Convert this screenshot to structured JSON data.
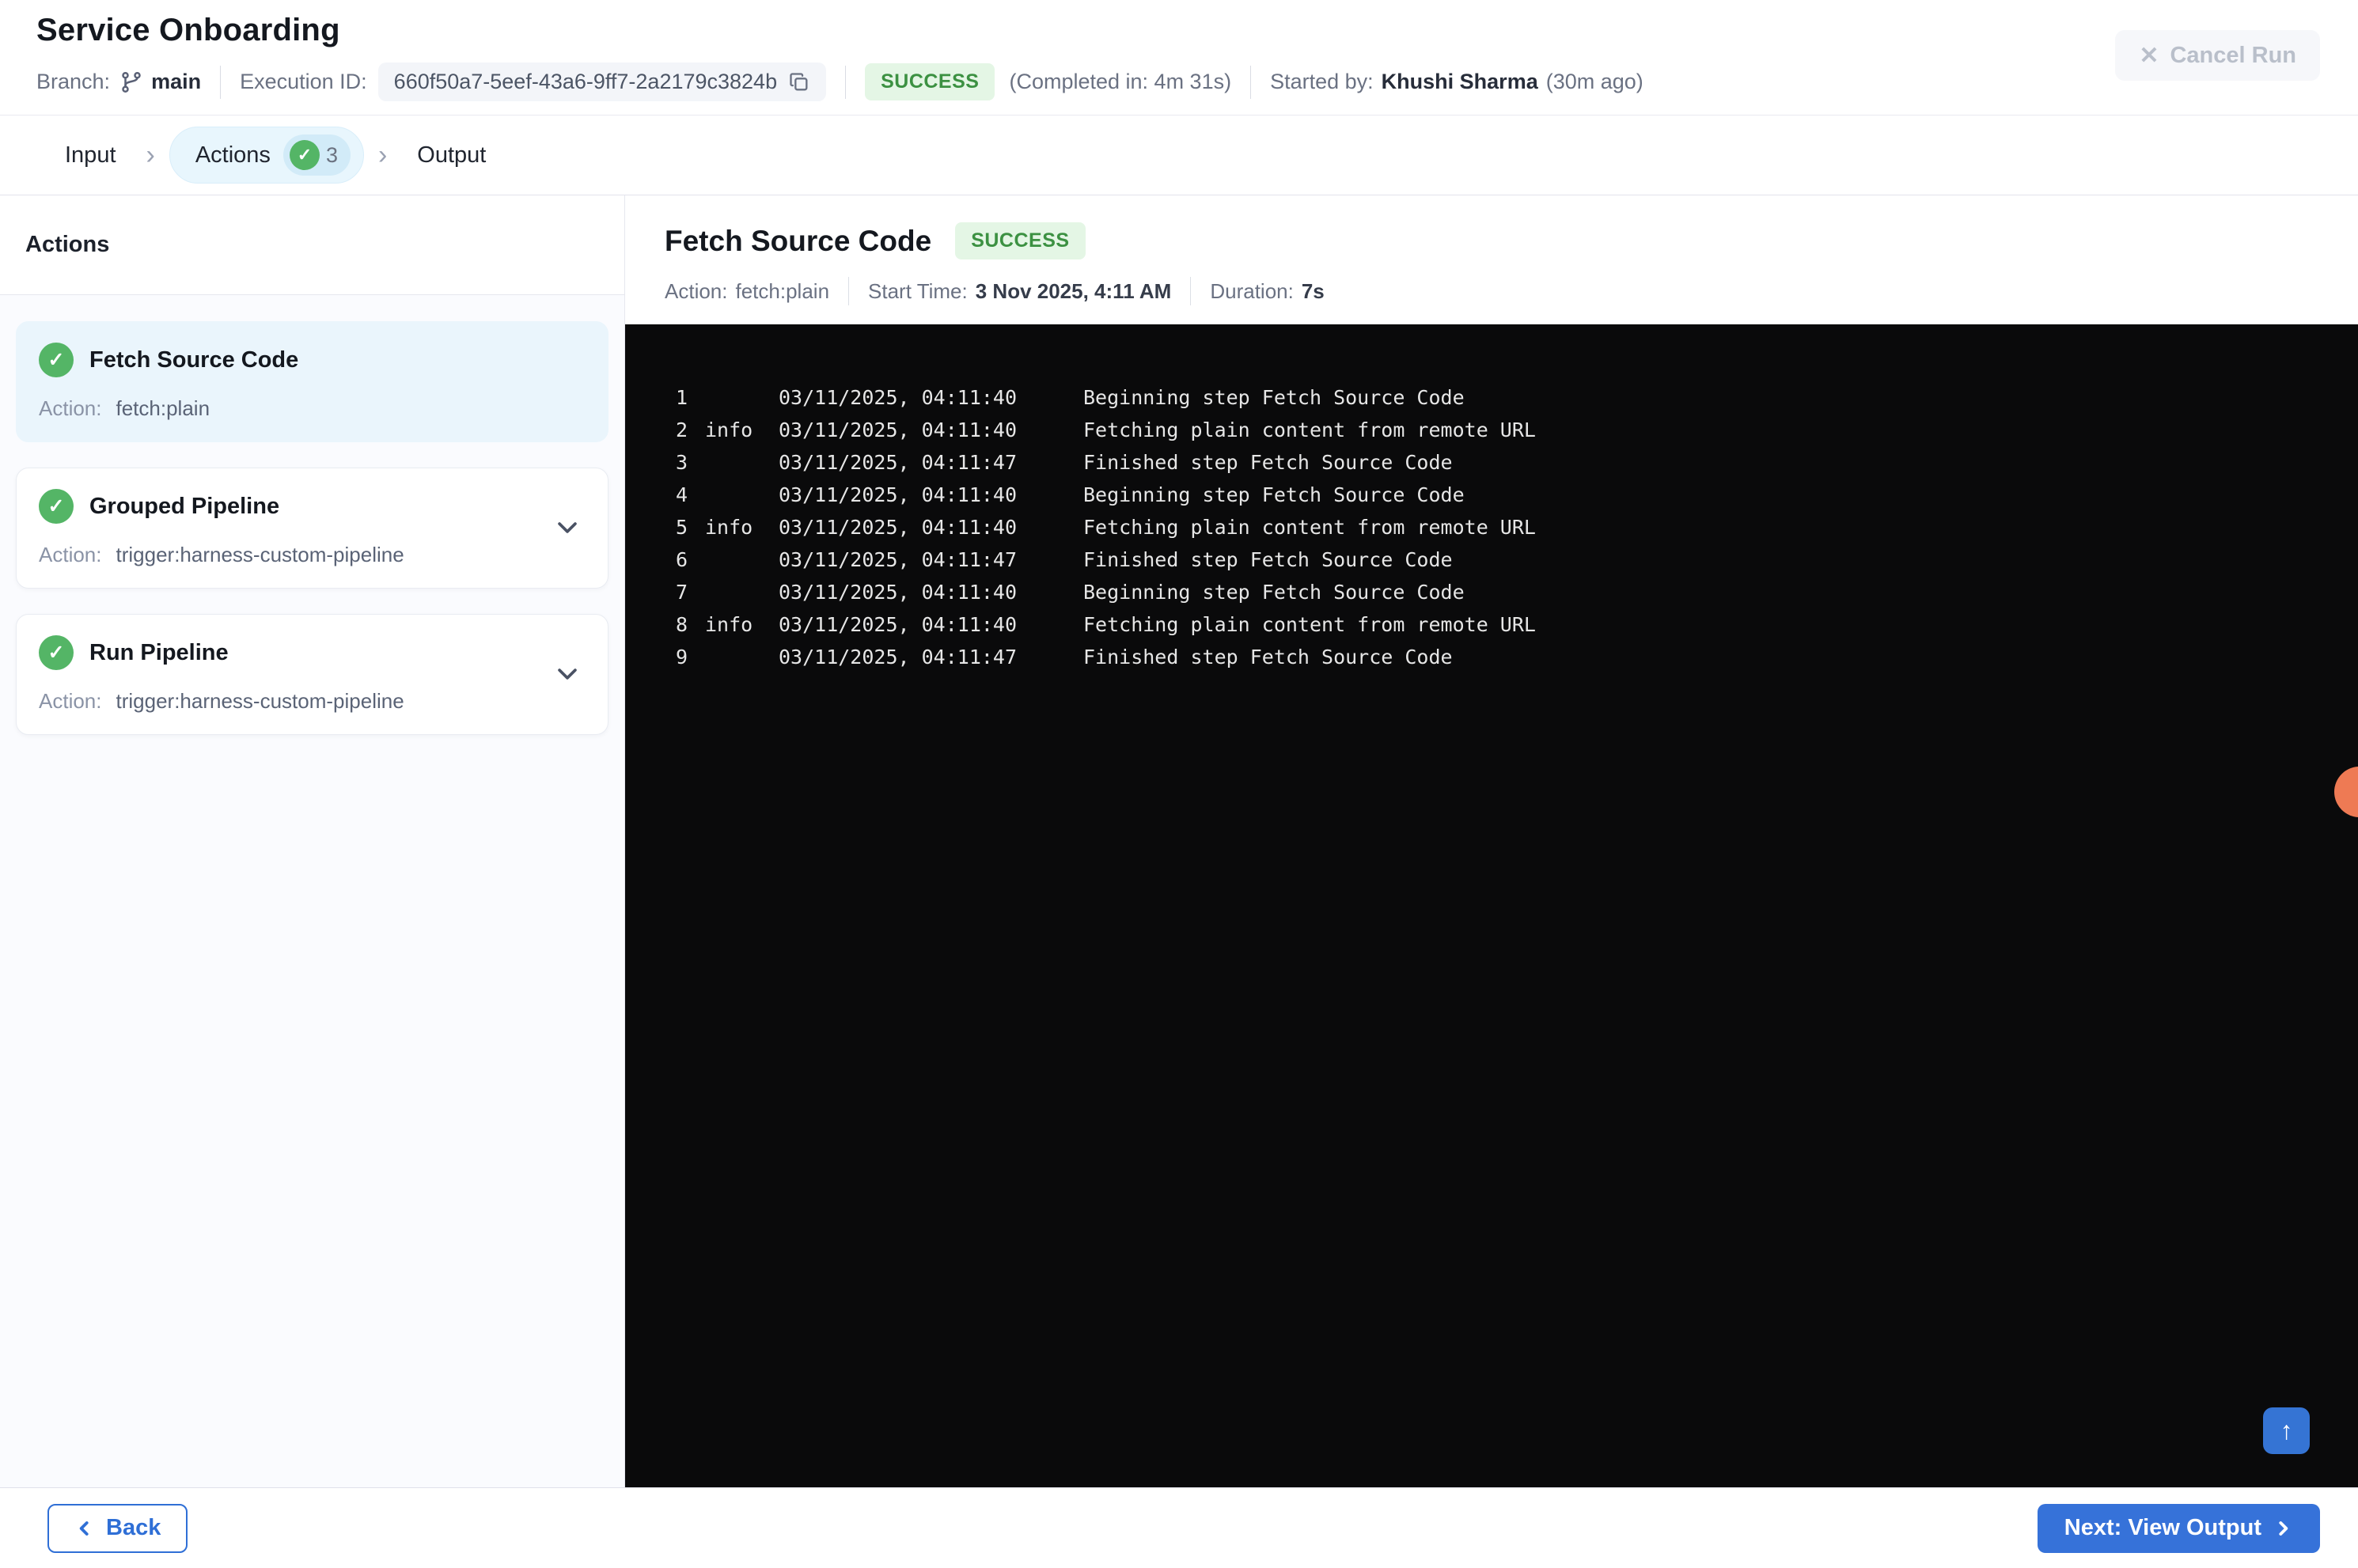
{
  "header": {
    "title": "Service Onboarding",
    "branch_label": "Branch:",
    "branch_name": "main",
    "execution_id_label": "Execution ID:",
    "execution_id": "660f50a7-5eef-43a6-9ff7-2a2179c3824b",
    "status_badge": "SUCCESS",
    "completed_in": "(Completed in: 4m 31s)",
    "started_by_label": "Started by:",
    "started_by_name": "Khushi Sharma",
    "started_ago": "(30m ago)",
    "cancel_button_label": "Cancel Run"
  },
  "tabs": {
    "items": [
      {
        "label": "Input",
        "active": false
      },
      {
        "label": "Actions",
        "active": true,
        "badge_count": "3"
      },
      {
        "label": "Output",
        "active": false
      }
    ]
  },
  "sidebar": {
    "heading": "Actions",
    "action_label": "Action:",
    "items": [
      {
        "title": "Fetch Source Code",
        "action": "fetch:plain",
        "status": "success",
        "selected": true,
        "expandable": false
      },
      {
        "title": "Grouped Pipeline",
        "action": "trigger:harness-custom-pipeline",
        "status": "success",
        "selected": false,
        "expandable": true
      },
      {
        "title": "Run Pipeline",
        "action": "trigger:harness-custom-pipeline",
        "status": "success",
        "selected": false,
        "expandable": true
      }
    ]
  },
  "detail": {
    "title": "Fetch Source Code",
    "status_badge": "SUCCESS",
    "meta": {
      "action_label": "Action:",
      "action_value": "fetch:plain",
      "start_label": "Start Time:",
      "start_value": "3 Nov 2025, 4:11 AM",
      "duration_label": "Duration:",
      "duration_value": "7s"
    }
  },
  "logs": {
    "lines": [
      {
        "num": "1",
        "level": "",
        "time": "03/11/2025, 04:11:40",
        "message": "Beginning step Fetch Source Code"
      },
      {
        "num": "2",
        "level": "info",
        "time": "03/11/2025, 04:11:40",
        "message": "Fetching plain content from remote URL"
      },
      {
        "num": "3",
        "level": "",
        "time": "03/11/2025, 04:11:47",
        "message": "Finished step Fetch Source Code"
      },
      {
        "num": "4",
        "level": "",
        "time": "03/11/2025, 04:11:40",
        "message": "Beginning step Fetch Source Code"
      },
      {
        "num": "5",
        "level": "info",
        "time": "03/11/2025, 04:11:40",
        "message": "Fetching plain content from remote URL"
      },
      {
        "num": "6",
        "level": "",
        "time": "03/11/2025, 04:11:47",
        "message": "Finished step Fetch Source Code"
      },
      {
        "num": "7",
        "level": "",
        "time": "03/11/2025, 04:11:40",
        "message": "Beginning step Fetch Source Code"
      },
      {
        "num": "8",
        "level": "info",
        "time": "03/11/2025, 04:11:40",
        "message": "Fetching plain content from remote URL"
      },
      {
        "num": "9",
        "level": "",
        "time": "03/11/2025, 04:11:47",
        "message": "Finished step Fetch Source Code"
      }
    ]
  },
  "footer": {
    "back_button": "Back",
    "next_button": "Next: View Output"
  },
  "icons": {
    "check": "✓",
    "close": "✕",
    "arrow_up": "↑",
    "chevron_separator": "›"
  },
  "colors": {
    "accent_blue": "#3672d9",
    "success_green": "#54b566",
    "success_badge_bg": "#e4f6e5",
    "success_badge_text": "#3c9142",
    "active_tab_bg": "#e8f6fd",
    "selected_card_bg": "#eaf5fc",
    "console_bg": "#0a0a0b",
    "orange_marker": "#ee7a54"
  }
}
